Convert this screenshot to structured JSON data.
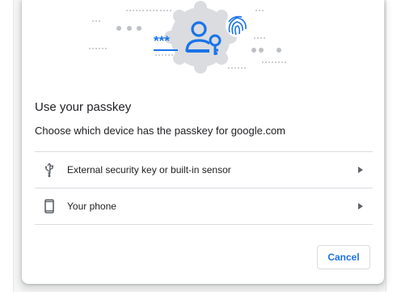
{
  "dialog": {
    "title": "Use your passkey",
    "subtitle": "Choose which device has the passkey for google.com",
    "options": [
      {
        "label": "External security key or built-in sensor",
        "icon": "usb-icon"
      },
      {
        "label": "Your phone",
        "icon": "phone-icon"
      }
    ],
    "cancel_label": "Cancel",
    "illustration": {
      "password_mask": "***",
      "icons": [
        "person-key-icon",
        "fingerprint-icon"
      ]
    }
  },
  "colors": {
    "accent": "#1a73e8",
    "text": "#202124",
    "divider": "#dadce0",
    "badge_bg": "#dadce0"
  }
}
